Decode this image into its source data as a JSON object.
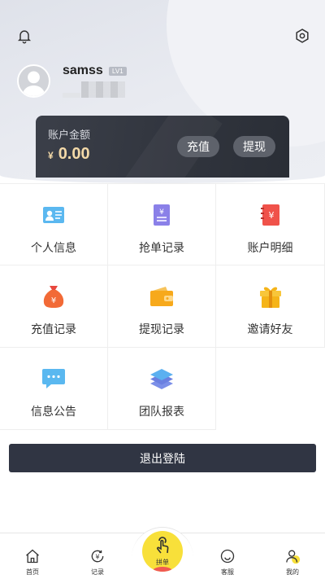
{
  "user": {
    "name": "samss",
    "level": "LV1"
  },
  "balance": {
    "label": "账户金额",
    "currency": "¥",
    "amount": "0.00",
    "recharge_label": "充值",
    "withdraw_label": "提现"
  },
  "menu": {
    "items": [
      {
        "label": "个人信息",
        "icon": "id-card-icon"
      },
      {
        "label": "抢单记录",
        "icon": "yen-document-icon"
      },
      {
        "label": "账户明细",
        "icon": "account-book-icon"
      },
      {
        "label": "充值记录",
        "icon": "money-bag-icon"
      },
      {
        "label": "提现记录",
        "icon": "wallet-icon"
      },
      {
        "label": "邀请好友",
        "icon": "gift-icon"
      },
      {
        "label": "信息公告",
        "icon": "message-icon"
      },
      {
        "label": "团队报表",
        "icon": "layers-icon"
      }
    ]
  },
  "logout_label": "退出登陆",
  "nav": {
    "home": "首页",
    "records": "记录",
    "center": "拼单",
    "service": "客服",
    "mine": "我的"
  },
  "colors": {
    "dark": "#303543",
    "gold_text": "#f3d9a8",
    "accent_yellow": "#f8e03a"
  }
}
